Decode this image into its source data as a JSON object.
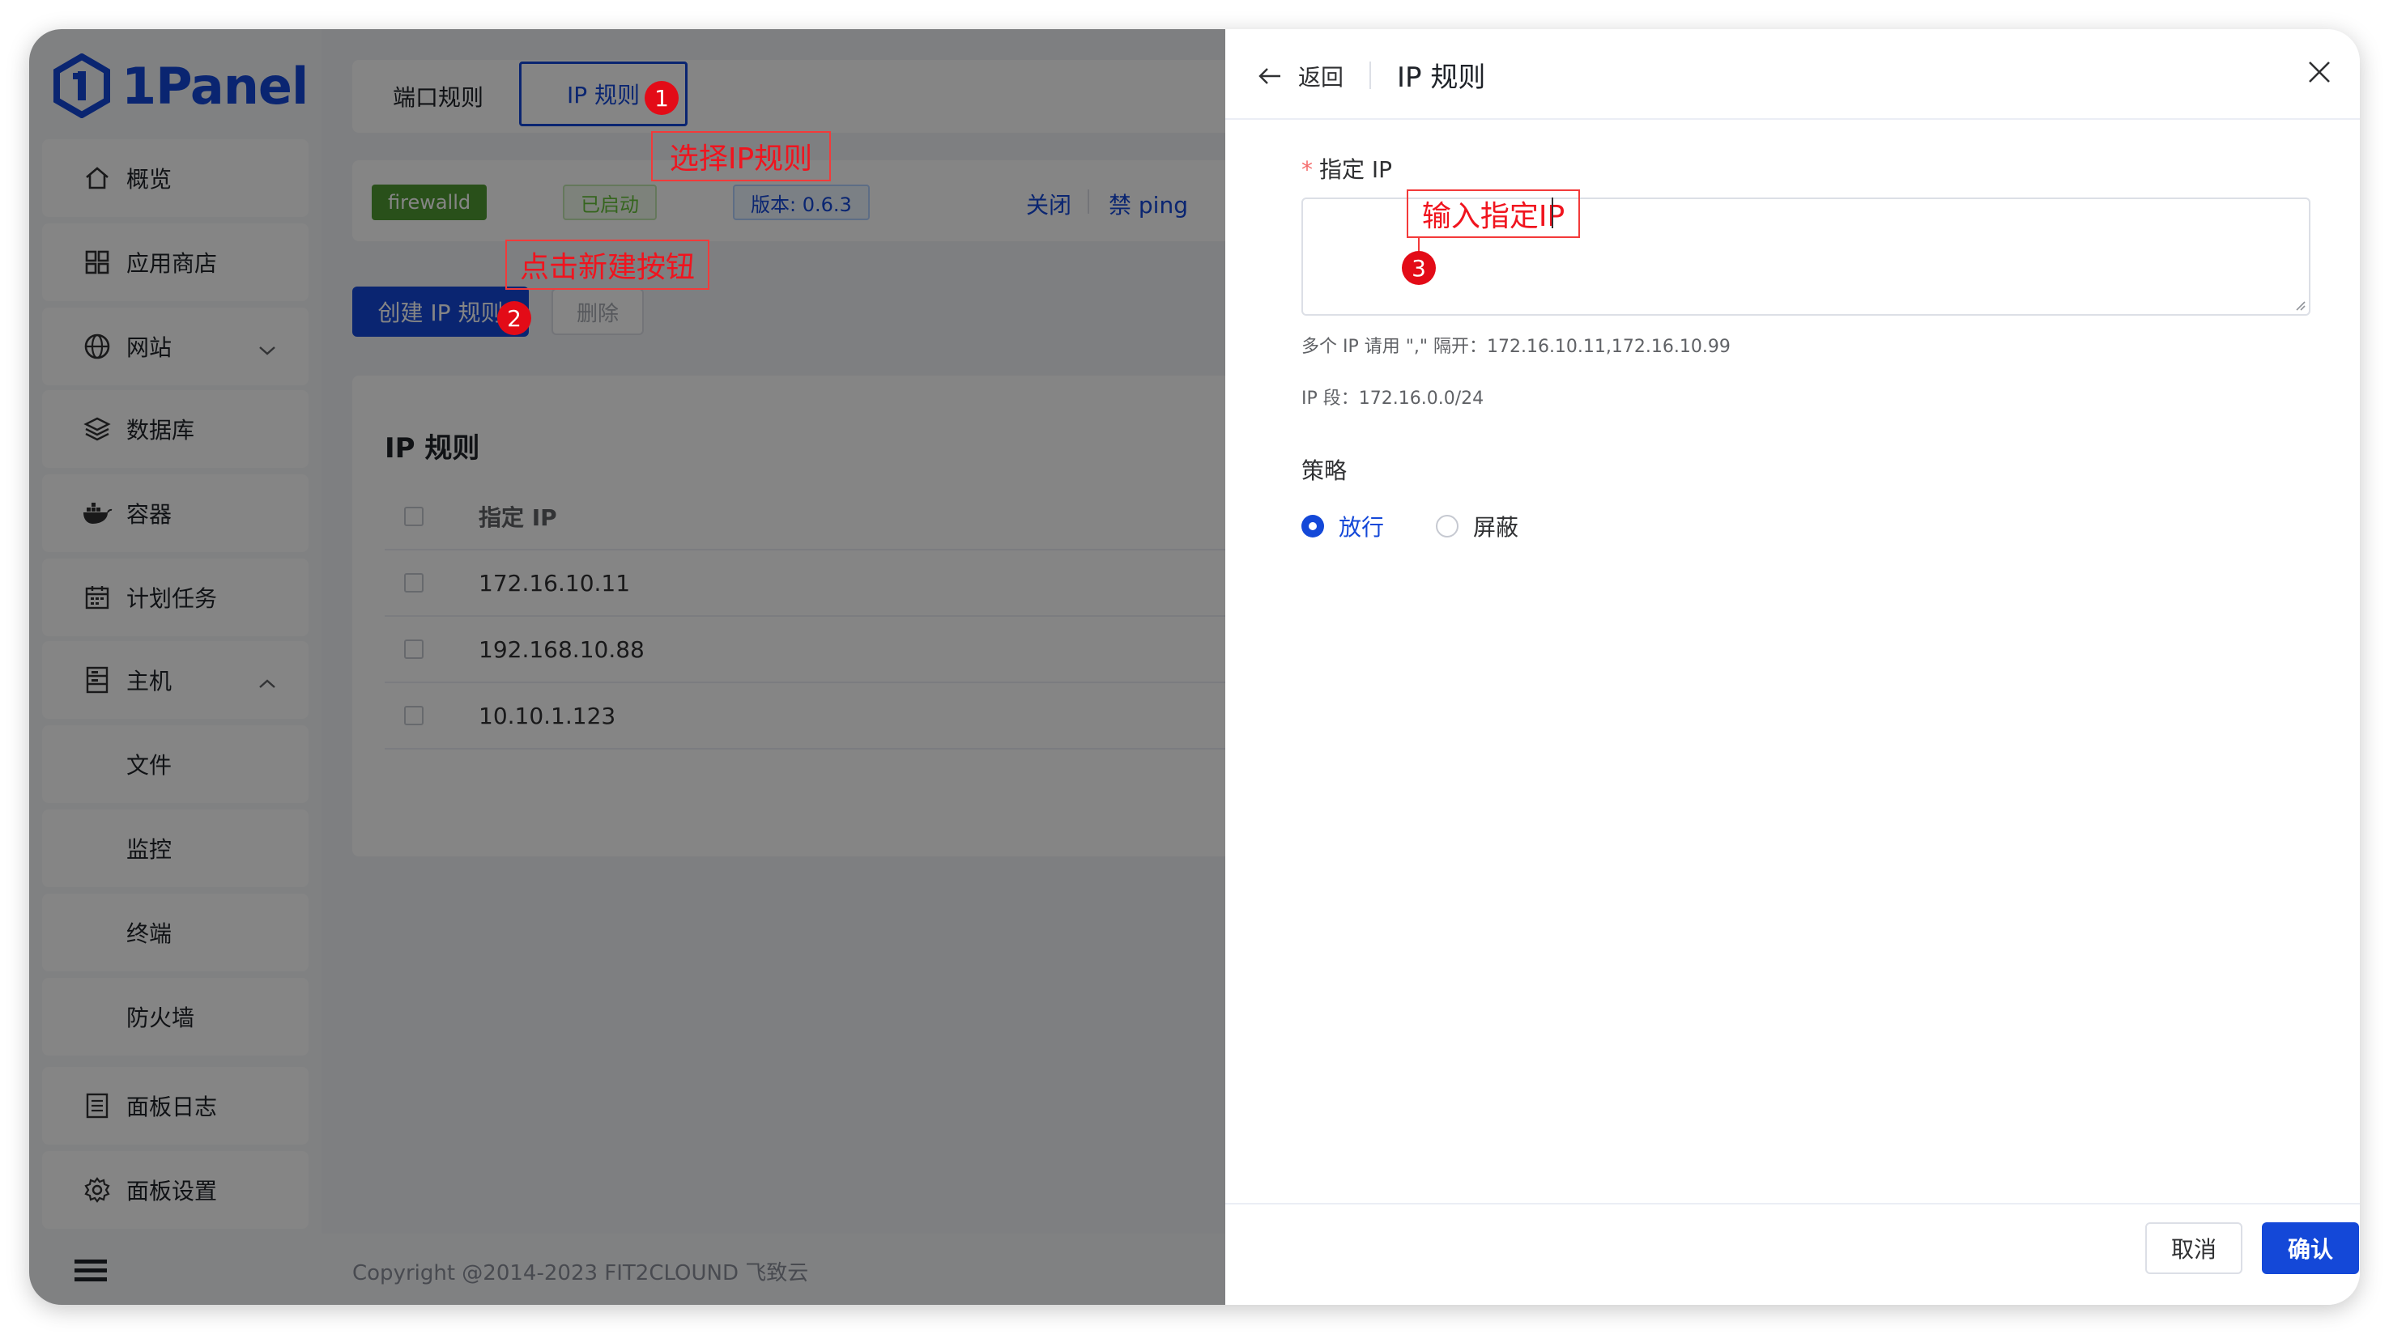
{
  "app": {
    "name": "1Panel"
  },
  "sidebar": {
    "items": [
      {
        "label": "概览",
        "icon": "home-icon"
      },
      {
        "label": "应用商店",
        "icon": "grid-icon"
      },
      {
        "label": "网站",
        "icon": "globe-icon"
      },
      {
        "label": "数据库",
        "icon": "layers-icon"
      },
      {
        "label": "容器",
        "icon": "docker-icon"
      },
      {
        "label": "计划任务",
        "icon": "calendar-icon"
      },
      {
        "label": "主机",
        "icon": "server-icon"
      },
      {
        "label": "文件"
      },
      {
        "label": "监控"
      },
      {
        "label": "终端"
      },
      {
        "label": "防火墙"
      },
      {
        "label": "面板日志",
        "icon": "log-icon"
      },
      {
        "label": "面板设置",
        "icon": "gear-icon"
      }
    ]
  },
  "tabs": {
    "port_rules": "端口规则",
    "ip_rules": "IP 规则"
  },
  "status": {
    "engine": "firewalld",
    "state": "已启动",
    "version": "版本: 0.6.3",
    "action_close": "关闭",
    "action_ping": "禁 ping"
  },
  "toolbar": {
    "create_label": "创建 IP 规则",
    "delete_label": "删除"
  },
  "table": {
    "title": "IP 规则",
    "header": "指定 IP",
    "rows": [
      "172.16.10.11",
      "192.168.10.88",
      "10.10.1.123"
    ]
  },
  "footer": {
    "copyright": "Copyright @2014-2023 FIT2CLOUND 飞致云"
  },
  "annotations": {
    "select_ip_rules": "选择IP规则",
    "click_create": "点击新建按钮",
    "enter_ip": "输入指定IP",
    "badge1": "1",
    "badge2": "2",
    "badge3": "3"
  },
  "drawer": {
    "back_label": "返回",
    "title": "IP 规则",
    "field_required": "*",
    "field_label": "指定 IP",
    "hint_multi": "多个 IP 请用 \",\" 隔开：172.16.10.11,172.16.10.99",
    "hint_segment": "IP 段：172.16.0.0/24",
    "strategy_label": "策略",
    "option_allow": "放行",
    "option_block": "屏蔽",
    "cancel_label": "取消",
    "confirm_label": "确认"
  },
  "colors": {
    "brand": "#1448d8",
    "annotation": "#f0141e",
    "tag_green": "#5aa53a"
  }
}
